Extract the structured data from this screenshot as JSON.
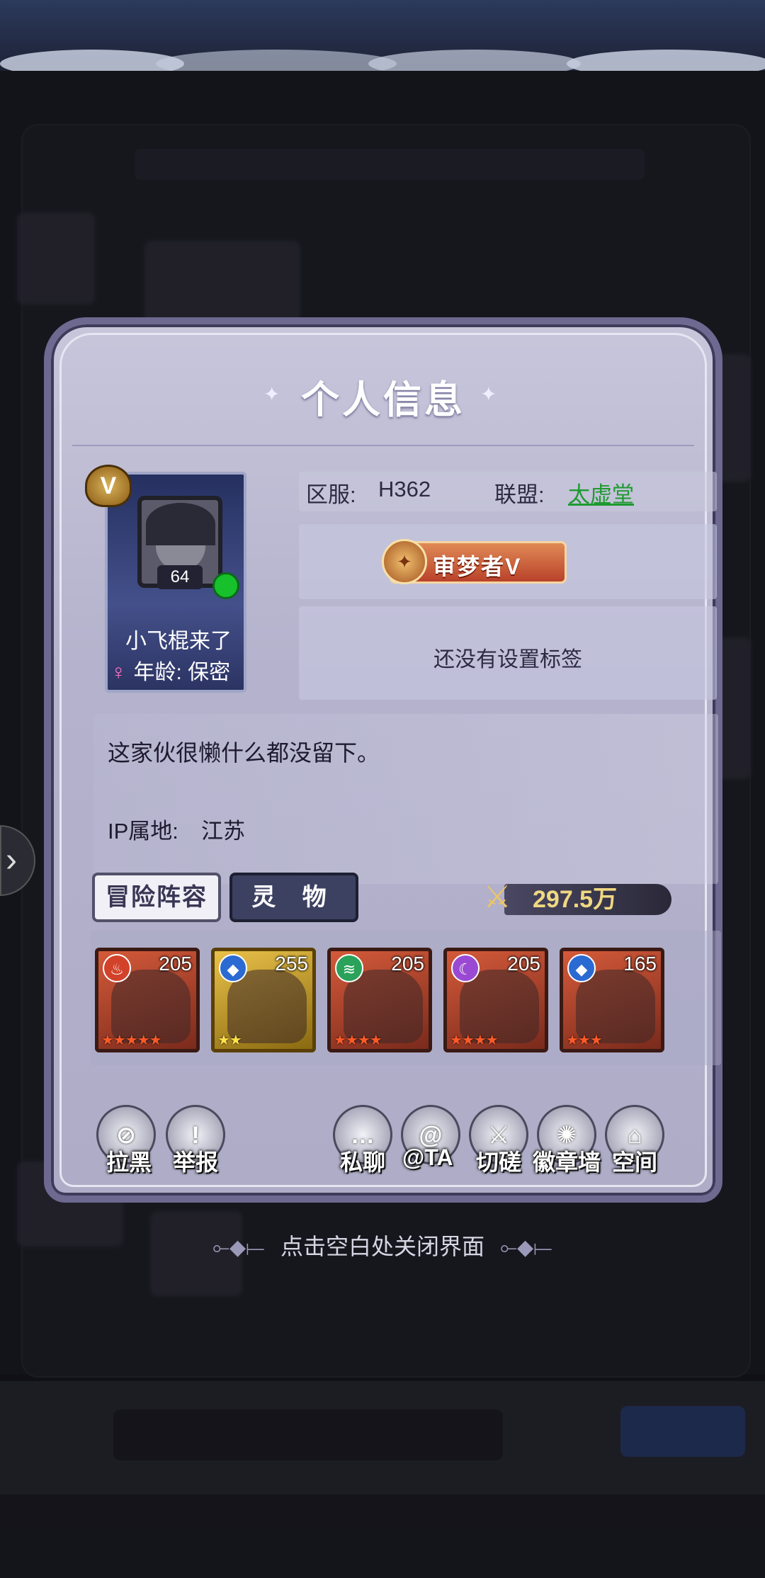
{
  "dialog": {
    "title": "个人信息",
    "server_label": "区服:",
    "server_value": "H362",
    "alliance_label": "联盟:",
    "alliance_value": "太虚堂",
    "title_badge": "审梦者V",
    "tag_text": "还没有设置标签",
    "bio": "这家伙很懒什么都没留下。",
    "ip_label": "IP属地:",
    "ip_value": "江苏"
  },
  "player": {
    "vip_badge": "V",
    "level": "64",
    "name": "小飞棍来了",
    "gender_icon": "♀",
    "age_text": "年龄: 保密",
    "online_color": "#16c12c"
  },
  "tabs": {
    "lineup": "冒险阵容",
    "spirit": "灵 物"
  },
  "power": {
    "value": "297.5万"
  },
  "heroes": [
    {
      "level": "205",
      "stars": "★★★★★",
      "element_icon": "fire-icon"
    },
    {
      "level": "255",
      "stars": "★★",
      "element_icon": "water-icon"
    },
    {
      "level": "205",
      "stars": "★★★★",
      "element_icon": "wind-icon"
    },
    {
      "level": "205",
      "stars": "★★★★",
      "element_icon": "moon-icon"
    },
    {
      "level": "165",
      "stars": "★★★",
      "element_icon": "water-icon"
    }
  ],
  "actions": {
    "block": "拉黑",
    "report": "举报",
    "private_chat": "私聊",
    "mention": "@TA",
    "duel": "切磋",
    "badge_wall": "徽章墙",
    "space": "空间"
  },
  "close_hint": "点击空白处关闭界面"
}
